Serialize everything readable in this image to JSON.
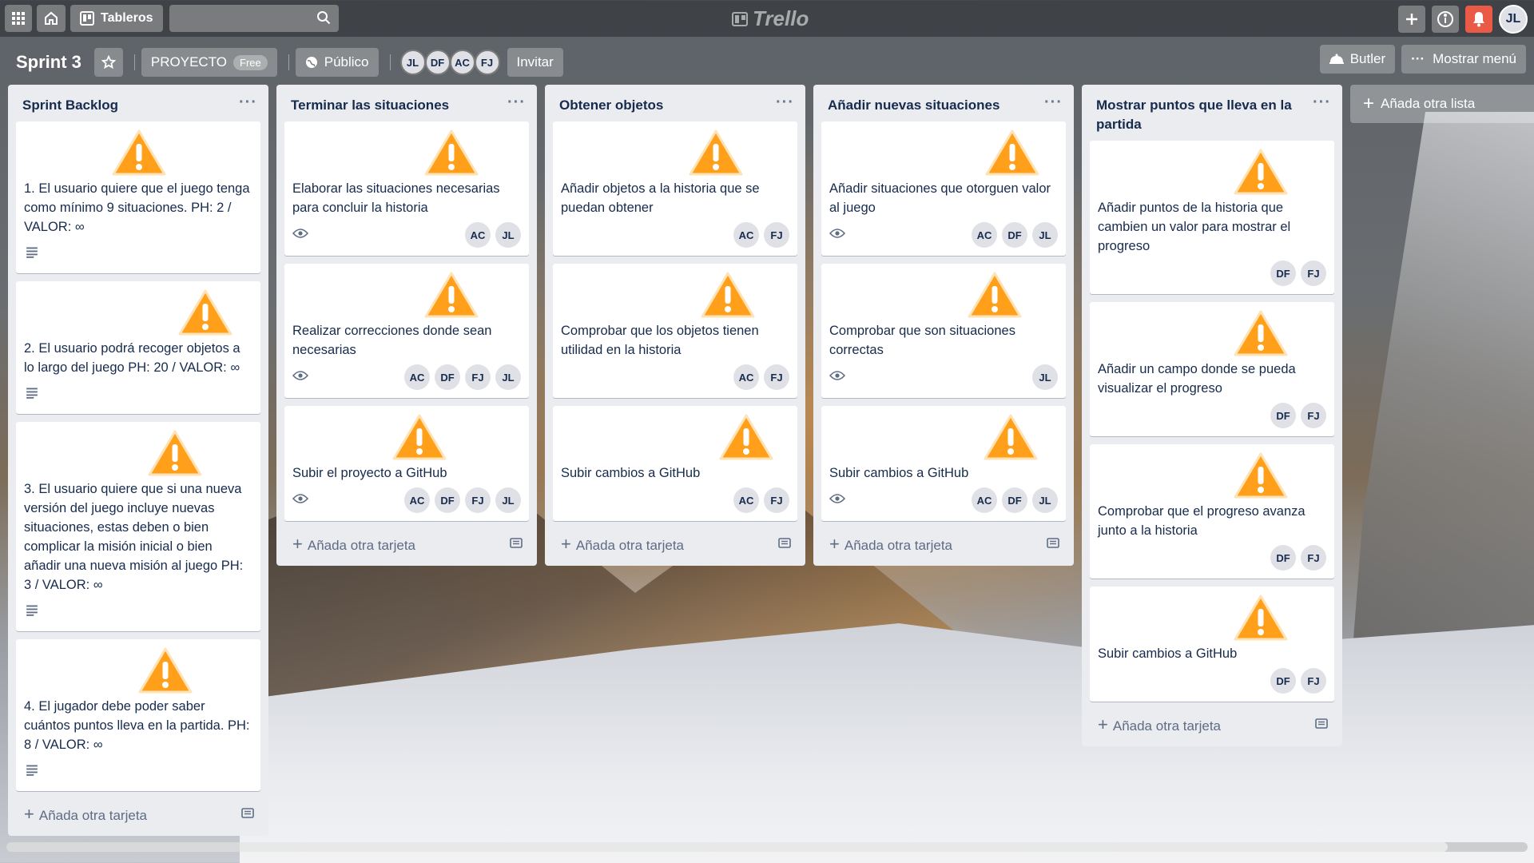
{
  "header": {
    "apps_icon": "grid-icon",
    "home_icon": "home-icon",
    "boards_label": "Tableros",
    "search_placeholder": "",
    "logo_text": "Trello",
    "user_initials": "JL"
  },
  "board": {
    "title": "Sprint 3",
    "team_label": "PROYECTO",
    "plan_badge": "Free",
    "visibility_label": "Público",
    "members": [
      "JL",
      "DF",
      "AC",
      "FJ"
    ],
    "invite_label": "Invitar",
    "butler_label": "Butler",
    "menu_label": "Mostrar menú"
  },
  "add_card_label": "Añada otra tarjeta",
  "add_list_label": "Añada otra lista",
  "colors": {
    "warning": "#ff9f1a",
    "card_bg": "#ffffff",
    "list_bg": "#ebecf0",
    "notification": "#eb5a46"
  },
  "lists": [
    {
      "title": "Sprint Backlog",
      "cards": [
        {
          "text": "1. El usuario quiere que el juego tenga como mínimo 9 situaciones. PH: 2 / VALOR: ∞",
          "badge": "description-icon",
          "members": []
        },
        {
          "text": "2. El usuario podrá recoger objetos a lo largo del juego PH: 20 / VALOR: ∞",
          "badge": "description-icon",
          "members": []
        },
        {
          "text": "3. El usuario quiere que si una nueva versión del juego incluye nuevas situaciones, estas deben o bien complicar la misión inicial o bien añadir una nueva misión al juego PH: 3 / VALOR: ∞",
          "badge": "description-icon",
          "members": []
        },
        {
          "text": "4. El jugador debe poder saber cuántos puntos lleva en la partida. PH: 8 / VALOR: ∞",
          "badge": "description-icon",
          "members": []
        }
      ]
    },
    {
      "title": "Terminar las situaciones",
      "cards": [
        {
          "text": "Elaborar las situaciones necesarias para concluir la historia",
          "badge": "eye-icon",
          "members": [
            "AC",
            "JL"
          ]
        },
        {
          "text": "Realizar correcciones donde sean necesarias",
          "badge": "eye-icon",
          "members": [
            "AC",
            "DF",
            "FJ",
            "JL"
          ]
        },
        {
          "text": "Subir el proyecto a GitHub",
          "badge": "eye-icon",
          "members": [
            "AC",
            "DF",
            "FJ",
            "JL"
          ]
        }
      ]
    },
    {
      "title": "Obtener objetos",
      "cards": [
        {
          "text": "Añadir objetos a la historia que se puedan obtener",
          "badge": "",
          "members": [
            "AC",
            "FJ"
          ]
        },
        {
          "text": "Comprobar que los objetos tienen utilidad en la historia",
          "badge": "",
          "members": [
            "AC",
            "FJ"
          ]
        },
        {
          "text": "Subir cambios a GitHub",
          "badge": "",
          "members": [
            "AC",
            "FJ"
          ]
        }
      ]
    },
    {
      "title": "Añadir nuevas situaciones",
      "cards": [
        {
          "text": "Añadir situaciones que otorguen valor al juego",
          "badge": "eye-icon",
          "members": [
            "AC",
            "DF",
            "JL"
          ]
        },
        {
          "text": "Comprobar que son situaciones correctas",
          "badge": "eye-icon",
          "members": [
            "JL"
          ]
        },
        {
          "text": "Subir cambios a GitHub",
          "badge": "eye-icon",
          "members": [
            "AC",
            "DF",
            "JL"
          ]
        }
      ]
    },
    {
      "title": "Mostrar puntos que lleva en la partida",
      "cards": [
        {
          "text": "Añadir puntos de la historia que cambien un valor para mostrar el progreso",
          "badge": "",
          "members": [
            "DF",
            "FJ"
          ]
        },
        {
          "text": "Añadir un campo donde se pueda visualizar el progreso",
          "badge": "",
          "members": [
            "DF",
            "FJ"
          ]
        },
        {
          "text": "Comprobar que el progreso avanza junto a la historia",
          "badge": "",
          "members": [
            "DF",
            "FJ"
          ]
        },
        {
          "text": "Subir cambios a GitHub",
          "badge": "",
          "members": [
            "DF",
            "FJ"
          ]
        }
      ]
    }
  ]
}
